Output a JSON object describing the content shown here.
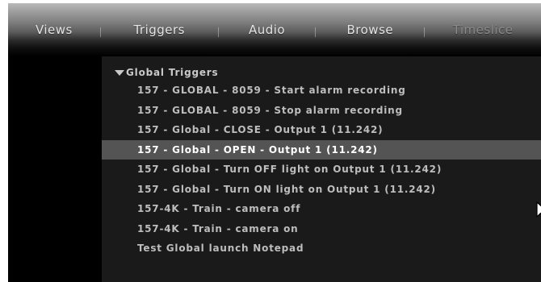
{
  "tabs": [
    {
      "label": "Views",
      "state": "normal"
    },
    {
      "label": "Triggers",
      "state": "normal"
    },
    {
      "label": "Audio",
      "state": "normal"
    },
    {
      "label": "Browse",
      "state": "normal"
    },
    {
      "label": "Timeslice",
      "state": "disabled"
    }
  ],
  "tree": {
    "group_label": "Global Triggers",
    "expanded": true,
    "selected_index": 3,
    "items": [
      {
        "label": "157 - GLOBAL - 8059 - Start alarm recording"
      },
      {
        "label": "157 - GLOBAL - 8059 - Stop alarm recording"
      },
      {
        "label": "157 - Global - CLOSE - Output 1 (11.242)"
      },
      {
        "label": "157 - Global - OPEN - Output 1 (11.242)"
      },
      {
        "label": "157 - Global - Turn OFF light on Output 1 (11.242)"
      },
      {
        "label": "157 - Global - Turn ON light on Output 1 (11.242)"
      },
      {
        "label": "157-4K - Train - camera off"
      },
      {
        "label": "157-4K - Train - camera on"
      },
      {
        "label": "Test Global launch Notepad"
      }
    ]
  },
  "colors": {
    "background": "#000000",
    "list_panel": "#1a1a1a",
    "selected_row": "#545454",
    "text": "#bdbdbd",
    "selected_text": "#ffffff"
  },
  "icons": {
    "expand": "triangle-down-icon",
    "pointer": "mouse-cursor-icon"
  }
}
